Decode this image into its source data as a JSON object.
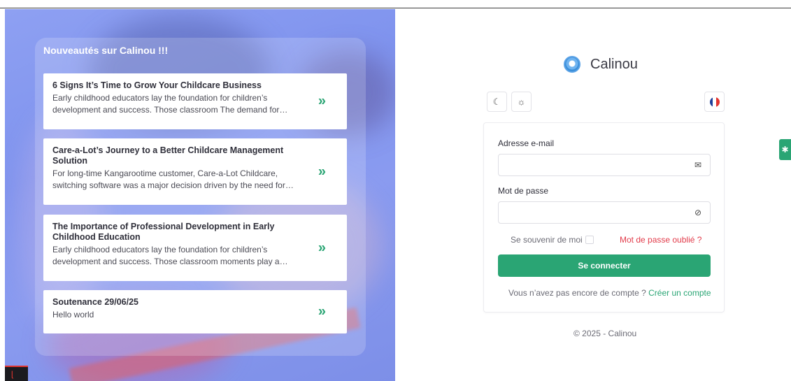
{
  "news": {
    "title": "Nouveautés sur Calinou !!!",
    "items": [
      {
        "title": "6 Signs It’s Time to Grow Your Childcare Business",
        "desc": "Early childhood educators lay the foundation for children’s development and success. Those classroom The demand for…",
        "arrow": "»"
      },
      {
        "title": "Care-a-Lot’s Journey to a Better Childcare Management Solution",
        "desc": "For long-time Kangarootime customer, Care-a-Lot Childcare, switching software was a major decision driven by the need for…",
        "arrow": "»"
      },
      {
        "title": "The Importance of Professional Development in Early Childhood Education",
        "desc": "Early childhood educators lay the foundation for children’s development and success. Those classroom moments play a…",
        "arrow": "»"
      },
      {
        "title": "Soutenance 29/06/25",
        "desc": "Hello world",
        "arrow": "»"
      }
    ]
  },
  "brand": {
    "name": "Calinou",
    "logo_icon": "calinou-logo-icon"
  },
  "toolbar": {
    "dark_icon": "☾",
    "light_icon": "☼",
    "flag_colors": [
      "#1f3f9a",
      "#ffffff",
      "#e3342f"
    ]
  },
  "form": {
    "email_label": "Adresse e-mail",
    "email_value": "",
    "email_icon": "✉",
    "password_label": "Mot de passe",
    "password_value": "",
    "password_icon": "⊘",
    "remember_label": "Se souvenir de moi",
    "forgot_label": "Mot de passe oublié ?",
    "submit_label": "Se connecter",
    "signup_prompt": "Vous n’avez pas encore de compte ?",
    "signup_link": "Créer un compte"
  },
  "footer": {
    "copyright": "© 2025 - Calinou"
  },
  "settings_icon": "✱",
  "laravel_icon": "ɭ",
  "accent": "#2aa574"
}
